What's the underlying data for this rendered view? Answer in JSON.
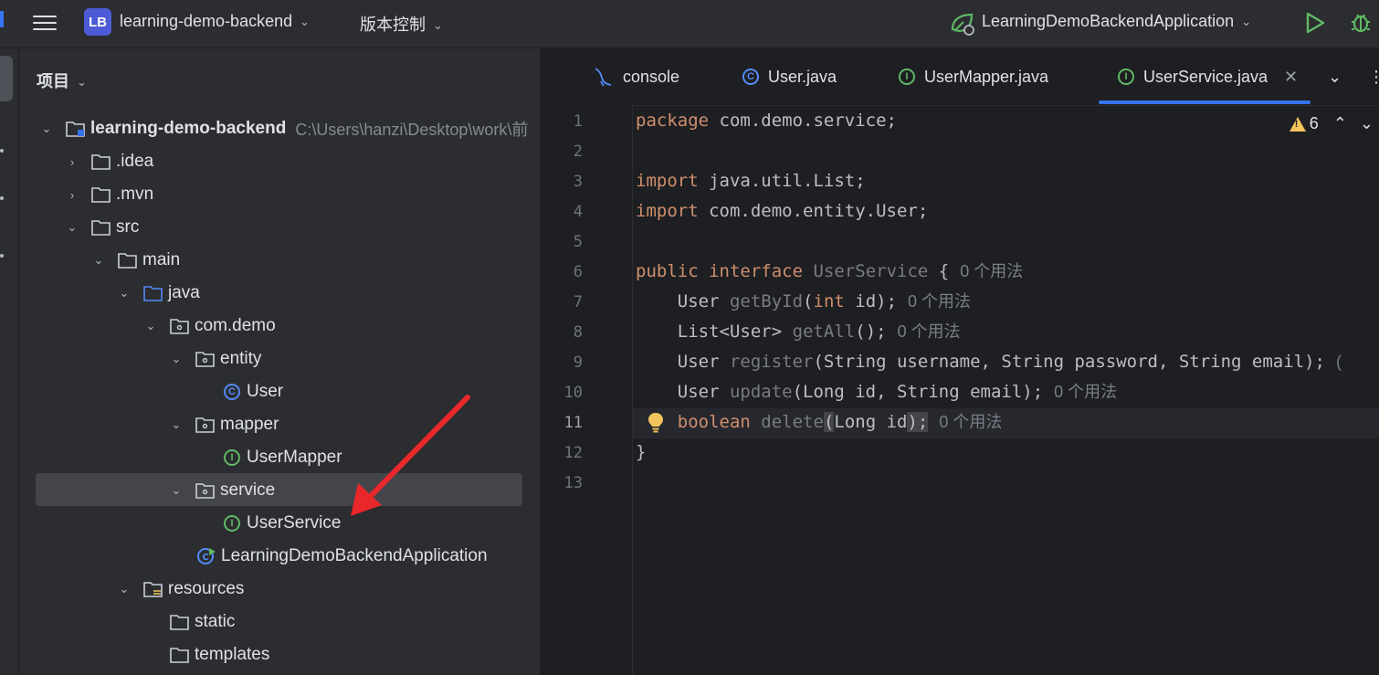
{
  "titlebar": {
    "project_badge": "LB",
    "project_name": "learning-demo-backend",
    "vcs_menu": "版本控制",
    "run_config": "LearningDemoBackendApplication",
    "icons": [
      "menu-icon",
      "run-icon",
      "debug-icon"
    ]
  },
  "project_panel": {
    "title": "项目",
    "tree": [
      {
        "label": "learning-demo-backend",
        "path": "C:\\Users\\hanzi\\Desktop\\work\\前",
        "icon": "module-folder-icon",
        "expanded": true
      },
      {
        "label": ".idea",
        "icon": "folder-icon",
        "expanded": false
      },
      {
        "label": ".mvn",
        "icon": "folder-icon",
        "expanded": false
      },
      {
        "label": "src",
        "icon": "folder-icon",
        "expanded": true
      },
      {
        "label": "main",
        "icon": "folder-icon",
        "expanded": true
      },
      {
        "label": "java",
        "icon": "source-folder-icon",
        "expanded": true
      },
      {
        "label": "com.demo",
        "icon": "package-icon",
        "expanded": true
      },
      {
        "label": "entity",
        "icon": "package-icon",
        "expanded": true
      },
      {
        "label": "User",
        "icon": "class-icon"
      },
      {
        "label": "mapper",
        "icon": "package-icon",
        "expanded": true
      },
      {
        "label": "UserMapper",
        "icon": "interface-icon"
      },
      {
        "label": "service",
        "icon": "package-icon",
        "expanded": true,
        "selected": true
      },
      {
        "label": "UserService",
        "icon": "interface-icon"
      },
      {
        "label": "LearningDemoBackendApplication",
        "icon": "spring-boot-class-icon"
      },
      {
        "label": "resources",
        "icon": "resources-folder-icon",
        "expanded": true
      },
      {
        "label": "static",
        "icon": "folder-icon"
      },
      {
        "label": "templates",
        "icon": "folder-icon"
      }
    ]
  },
  "editor": {
    "tabs": [
      {
        "label": "console",
        "icon": "database-console-icon"
      },
      {
        "label": "User.java",
        "icon": "class-icon"
      },
      {
        "label": "UserMapper.java",
        "icon": "interface-icon"
      },
      {
        "label": "UserService.java",
        "icon": "interface-icon",
        "active": true
      }
    ],
    "warnings_count": "6",
    "line_numbers": [
      "1",
      "2",
      "3",
      "4",
      "5",
      "6",
      "7",
      "8",
      "9",
      "10",
      "11",
      "12",
      "13"
    ],
    "current_line": "11",
    "code": {
      "l1_kw": "package",
      "l1_rest": " com.demo.service;",
      "l3_kw": "import",
      "l3_rest": " java.util.List;",
      "l4_kw": "import",
      "l4_rest": " com.demo.entity.User;",
      "l6_kw1": "public",
      "l6_kw2": "interface",
      "l6_name": "UserService",
      "l6_rest": " {",
      "l7_type": "User ",
      "l7_m": "getById",
      "l7_a": "(",
      "l7_kw": "int",
      "l7_b": " id);",
      "l8_type": "List<User> ",
      "l8_m": "getAll",
      "l8_b": "();",
      "l9_type": "User ",
      "l9_m": "register",
      "l9_b": "(String username, String password, String email);",
      "l10_type": "User ",
      "l10_m": "update",
      "l10_b": "(Long id, String email);",
      "l11_kw": "boolean",
      "l11_m": "delete",
      "l11_p": "(",
      "l11_b": "Long id",
      "l11_p2": ")",
      "l11_semi": ";",
      "l12": "}"
    },
    "usage_hint": "0 个用法",
    "usage_hint_cut": "("
  },
  "colors": {
    "accent": "#3574f0",
    "keyword": "#cf8e6d",
    "annotation_arrow": "#e8282b"
  }
}
